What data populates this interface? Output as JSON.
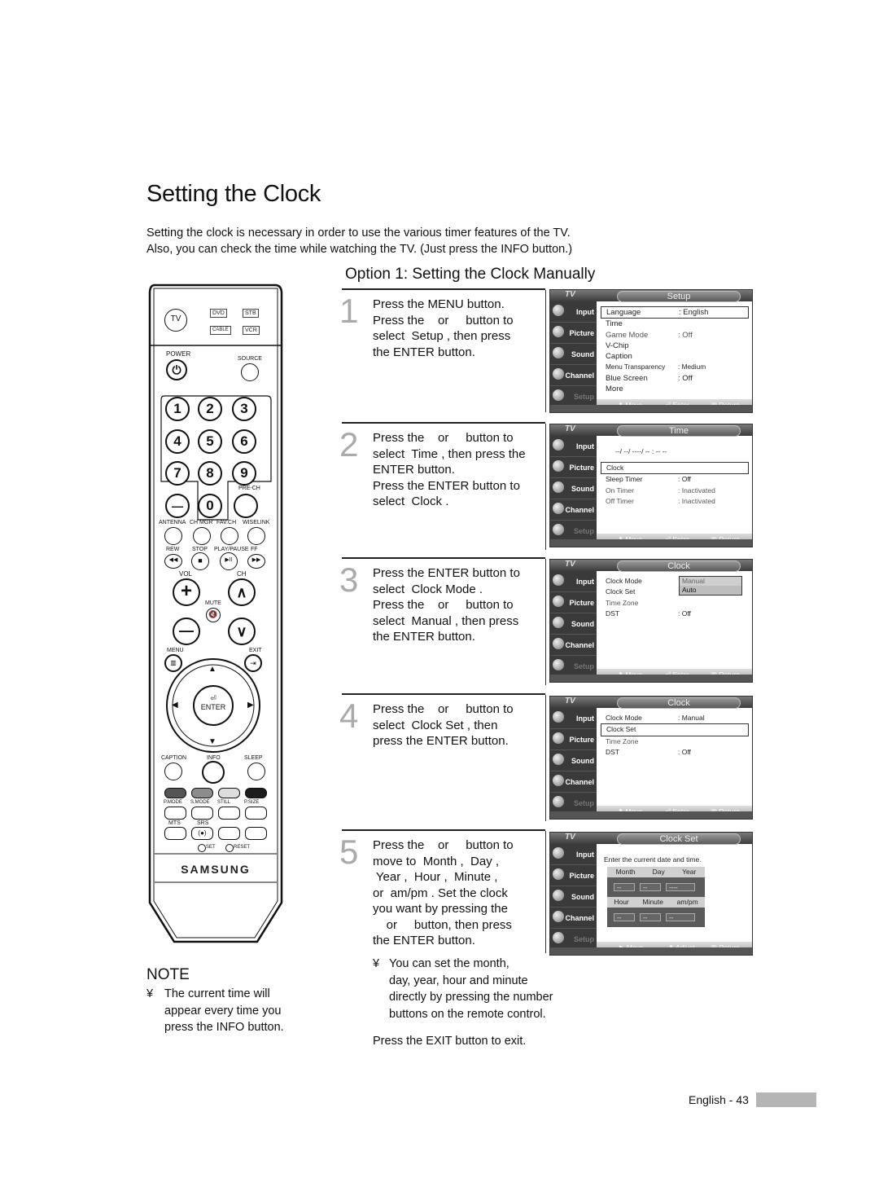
{
  "page": {
    "title": "Setting the Clock",
    "intro": [
      "Setting the clock is necessary in order to use the various timer features of the TV.",
      "Also, you can check the time while watching the TV. (Just press the INFO button.)"
    ],
    "subtitle": "Option 1: Setting the Clock Manually",
    "footer": {
      "label": "English - 43"
    }
  },
  "steps": [
    {
      "number": "1",
      "lines": [
        "Press the MENU button.",
        "Press the    or     button to",
        "select  Setup , then press",
        "the ENTER button."
      ]
    },
    {
      "number": "2",
      "lines": [
        "Press the    or     button to",
        "select  Time , then press the",
        "ENTER button.",
        "Press the ENTER button to",
        "select  Clock ."
      ]
    },
    {
      "number": "3",
      "lines": [
        "Press the ENTER button to",
        "select  Clock Mode .",
        "Press the    or     button to",
        "select  Manual , then press",
        "the ENTER button."
      ]
    },
    {
      "number": "4",
      "lines": [
        "Press the    or     button to",
        "select  Clock Set , then",
        "press the ENTER button."
      ]
    },
    {
      "number": "5",
      "lines": [
        "Press the    or     button to",
        "move to  Month ,  Day ,",
        " Year ,  Hour ,  Minute ,",
        "or  am/pm . Set the clock",
        "you want by pressing the",
        "    or     button, then press",
        "the ENTER button."
      ]
    }
  ],
  "step5_note": {
    "bullet": "¥",
    "lines": [
      "You can set the month,",
      "day, year, hour and minute",
      "directly by pressing the number",
      "buttons on the remote control."
    ]
  },
  "exit_text": "Press the EXIT button to exit.",
  "note": {
    "title": "NOTE",
    "bullet": "¥",
    "lines": [
      "The current time will",
      "appear every time you",
      "press the INFO button."
    ]
  },
  "osd_common": {
    "tv_label": "TV",
    "sidebar": [
      {
        "label": "Input",
        "icon": "input-icon"
      },
      {
        "label": "Picture",
        "icon": "picture-icon"
      },
      {
        "label": "Sound",
        "icon": "sound-icon"
      },
      {
        "label": "Channel",
        "icon": "channel-icon"
      },
      {
        "label": "Setup",
        "icon": "setup-icon"
      }
    ],
    "footer": {
      "move": "Move",
      "enter": "Enter",
      "return": "Return",
      "adjust": "Adjust"
    }
  },
  "screens": [
    {
      "tab": "Setup",
      "rows": [
        {
          "label": "Language",
          "value": ": English",
          "selected": true
        },
        {
          "label": "Time",
          "value": ""
        },
        {
          "label": "Game Mode",
          "value": ": Off",
          "grey": true
        },
        {
          "label": "V-Chip",
          "value": ""
        },
        {
          "label": "Caption",
          "value": ""
        },
        {
          "label": "Menu Transparency",
          "value": ": Medium",
          "small": true
        },
        {
          "label": "Blue Screen",
          "value": ": Off"
        },
        {
          "label": "  More",
          "value": ""
        }
      ]
    },
    {
      "tab": "Time",
      "datetime": "--/ --/ ----/ -- : -- --",
      "rows": [
        {
          "label": "Clock",
          "value": "",
          "selected": true
        },
        {
          "label": "Sleep Timer",
          "value": ": Off"
        },
        {
          "label": "On Timer",
          "value": ": Inactivated",
          "grey": true
        },
        {
          "label": "Off Timer",
          "value": ": Inactivated",
          "grey": true
        }
      ]
    },
    {
      "tab": "Clock",
      "rows": [
        {
          "label": "Clock Mode",
          "value": ""
        },
        {
          "label": "Clock Set",
          "value": ""
        },
        {
          "label": "Time Zone",
          "value": "",
          "grey": true
        },
        {
          "label": "DST",
          "value": ": Off"
        }
      ],
      "dropdown": [
        "Manual",
        "Auto"
      ]
    },
    {
      "tab": "Clock",
      "rows": [
        {
          "label": "Clock Mode",
          "value": ": Manual"
        },
        {
          "label": "Clock Set",
          "value": "",
          "selected": true
        },
        {
          "label": "Time Zone",
          "value": "",
          "grey": true
        },
        {
          "label": "DST",
          "value": ": Off"
        }
      ]
    },
    {
      "tab": "Clock Set",
      "hint": "Enter the current date and time.",
      "date_headers": [
        "Month",
        "Day",
        "Year"
      ],
      "date_values": [
        "--",
        "--",
        "----"
      ],
      "time_headers": [
        "Hour",
        "Minute",
        "am/pm"
      ],
      "time_values": [
        "--",
        "--",
        "--"
      ]
    }
  ],
  "remote": {
    "tv": "TV",
    "sources": [
      "DVD",
      "STB",
      "CABLE",
      "VCR"
    ],
    "power": "POWER",
    "source": "SOURCE",
    "digits": [
      "1",
      "2",
      "3",
      "4",
      "5",
      "6",
      "7",
      "8",
      "9",
      "0"
    ],
    "dash": "—",
    "prech": "PRE-CH",
    "row_labels": [
      "ANTENNA",
      "CH MGR",
      "FAV.CH",
      "WISELINK"
    ],
    "transport_labels": [
      "REW",
      "STOP",
      "PLAY/PAUSE",
      "FF"
    ],
    "transport_glyphs": [
      "◀◀",
      "■",
      "▶II",
      "▶▶"
    ],
    "vol": "VOL",
    "ch": "CH",
    "mute": "MUTE",
    "plus": "+",
    "minus": "—",
    "up": "∧",
    "down": "∨",
    "menu": "MENU",
    "exit": "EXIT",
    "enter": "ENTER",
    "caption": "CAPTION",
    "info": "INFO",
    "sleep": "SLEEP",
    "color_labels": [
      "P.MODE",
      "S.MODE",
      "STILL",
      "P.SIZE"
    ],
    "color_hex": [
      "#555555",
      "#8c8c8c",
      "#dddddd",
      "#1c1c1c"
    ],
    "mts": "MTS",
    "srs": "SRS",
    "set": "SET",
    "reset": "RESET",
    "brand": "SAMSUNG"
  }
}
